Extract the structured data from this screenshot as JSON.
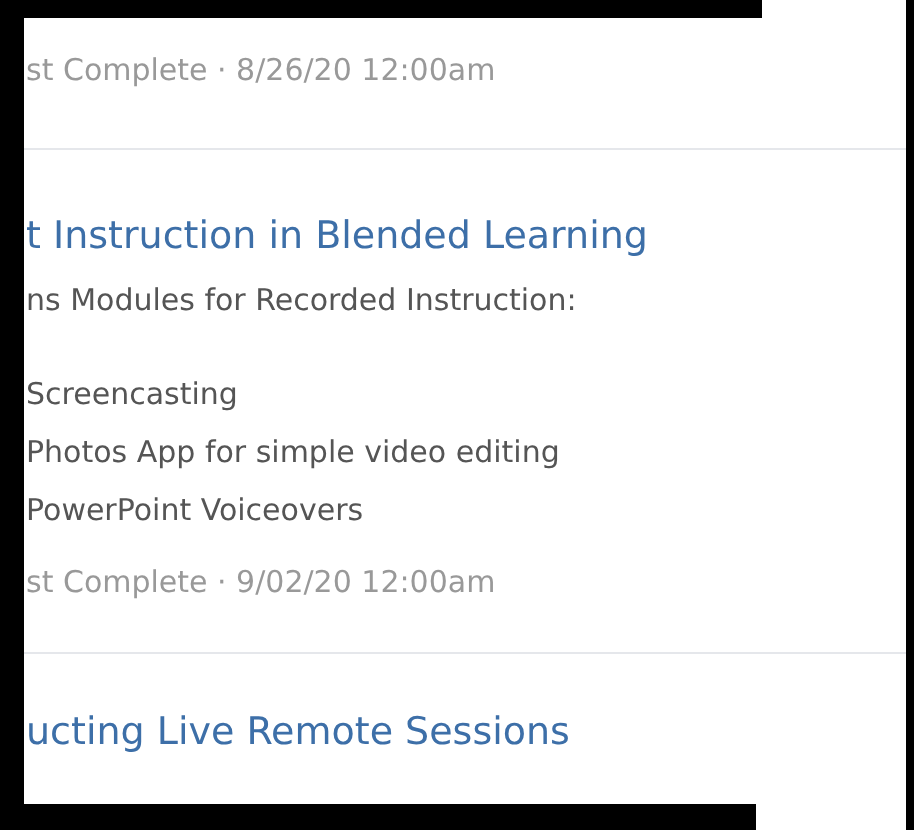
{
  "items": [
    {
      "meta": "st Complete · 8/26/20 12:00am"
    },
    {
      "title": "t Instruction in Blended Learning",
      "description": "ns Modules for Recorded Instruction:",
      "bullets": [
        "Screencasting",
        "Photos App for simple video editing",
        "PowerPoint Voiceovers"
      ],
      "meta": "st Complete · 9/02/20 12:00am"
    },
    {
      "title": "ucting Live Remote Sessions"
    }
  ]
}
